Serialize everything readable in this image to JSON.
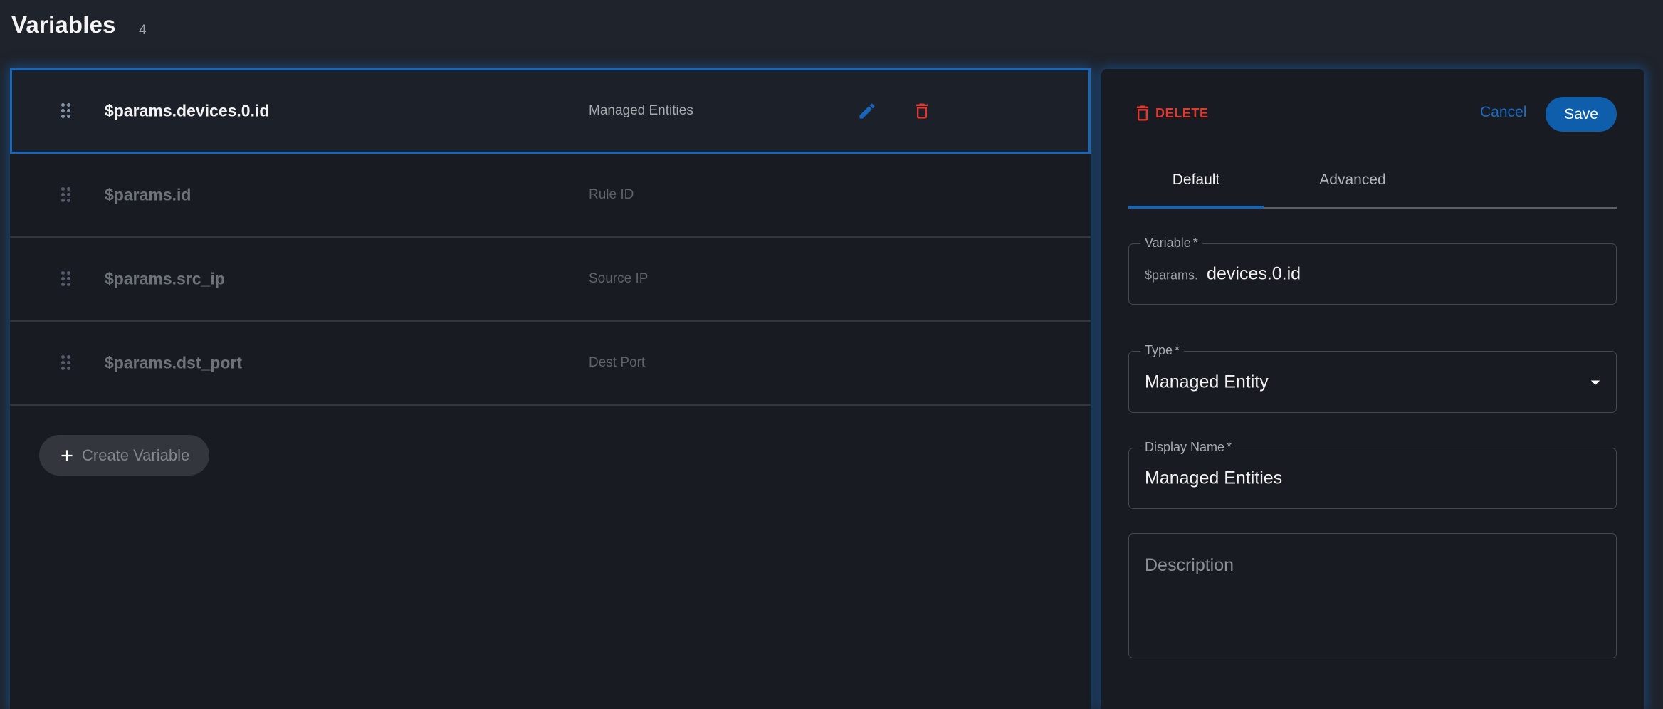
{
  "header": {
    "title": "Variables",
    "count": "4"
  },
  "variables": [
    {
      "name": "$params.devices.0.id",
      "display_name": "Managed Entities",
      "selected": true
    },
    {
      "name": "$params.id",
      "display_name": "Rule ID",
      "selected": false
    },
    {
      "name": "$params.src_ip",
      "display_name": "Source IP",
      "selected": false
    },
    {
      "name": "$params.dst_port",
      "display_name": "Dest Port",
      "selected": false
    }
  ],
  "row_actions": {
    "edit_icon": "pencil-icon",
    "delete_icon": "trash-icon",
    "drag_icon": "drag-handle-icon"
  },
  "create_button": {
    "label": "Create Variable",
    "icon": "plus-icon"
  },
  "editor": {
    "delete_label": "DELETE",
    "cancel_label": "Cancel",
    "save_label": "Save",
    "tabs": [
      {
        "label": "Default",
        "active": true
      },
      {
        "label": "Advanced",
        "active": false
      }
    ],
    "fields": {
      "variable": {
        "label": "Variable",
        "required_mark": "*",
        "prefix": "$params.",
        "value": "devices.0.id"
      },
      "type": {
        "label": "Type",
        "required_mark": "*",
        "value": "Managed Entity"
      },
      "display_name": {
        "label": "Display Name",
        "required_mark": "*",
        "value": "Managed Entities"
      },
      "description": {
        "placeholder": "Description",
        "value": ""
      }
    }
  },
  "colors": {
    "accent": "#1664b6",
    "danger": "#e0392f",
    "page_background": "#1f232b",
    "panel_background": "#181b22"
  }
}
